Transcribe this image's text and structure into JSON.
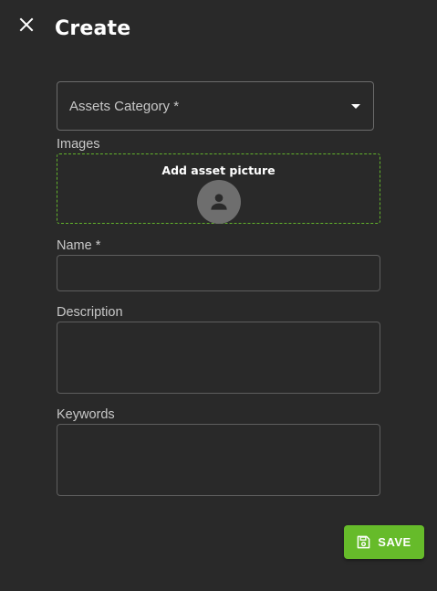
{
  "header": {
    "title": "Create",
    "close_icon": "close-icon"
  },
  "form": {
    "category": {
      "label": "Assets Category *",
      "value": "",
      "icon": "dropdown-caret-icon"
    },
    "images": {
      "label": "Images",
      "dropzone_text": "Add asset picture",
      "icon": "person-icon"
    },
    "name": {
      "label": "Name *",
      "value": "",
      "placeholder": ""
    },
    "description": {
      "label": "Description",
      "value": "",
      "placeholder": ""
    },
    "keywords": {
      "label": "Keywords",
      "value": "",
      "placeholder": ""
    }
  },
  "actions": {
    "save_label": "SAVE",
    "save_icon": "save-icon",
    "save_color": "#66bb2a"
  },
  "theme": {
    "background": "#292929",
    "accent": "#62b32b"
  }
}
